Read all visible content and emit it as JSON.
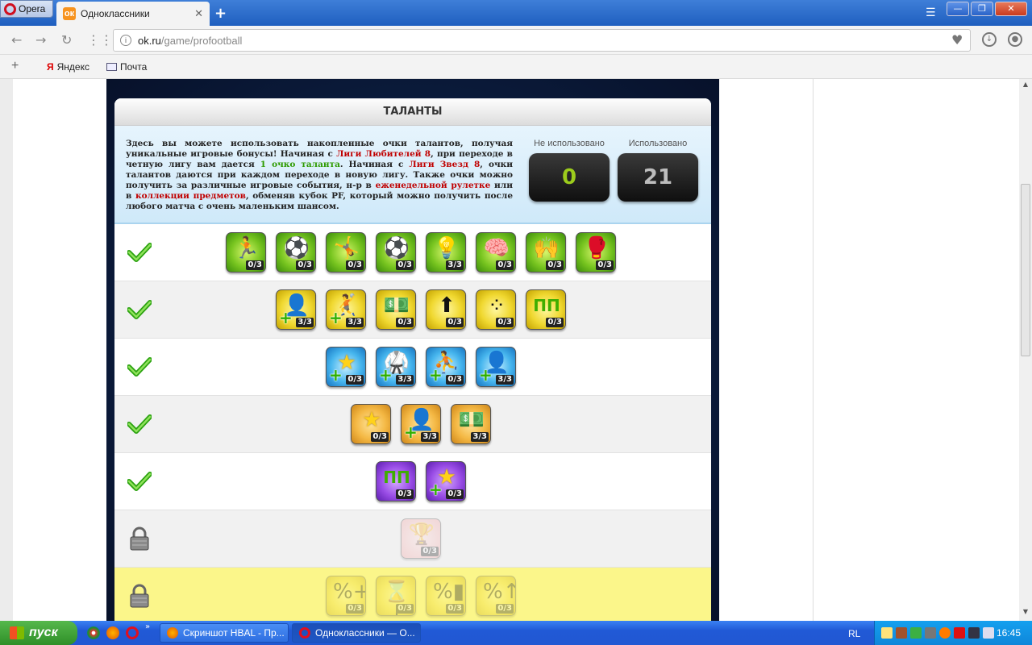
{
  "browser": {
    "menu_label": "Opera",
    "tab_title": "Одноклассники",
    "url_domain": "ok.ru",
    "url_path": "/game/profootball",
    "bookmarks": [
      {
        "label": "Яндекс"
      },
      {
        "label": "Почта"
      }
    ]
  },
  "panel": {
    "title": "ТАЛАНТЫ",
    "intro": {
      "p1": "Здесь вы можете использовать накопленные очки талантов, получая уникальные игровые бонусы! Начиная с ",
      "league1": "Лиги Любителей 8",
      "p2": ", при переходе в четную лигу вам дается ",
      "talent": "1 очко таланта",
      "p3": ". Начиная с ",
      "league2": "Лиги Звезд 8",
      "p4": ", очки талантов даются при каждом переходе в новую лигу. Также очки можно получить за различные игровые события, н-р в ",
      "roulette": "еженедельной рулетке",
      "p5": " или в ",
      "collection": "коллекции предметов",
      "p6": ", обменяв кубок PF, который можно получить после любого матча с очень маленьким шансом."
    },
    "unused_label": "Не использовано",
    "unused_value": "0",
    "used_label": "Использовано",
    "used_value": "21",
    "colors": {
      "unused": "#9ccc1c",
      "used": "#bdbdbd",
      "red": "#c00000",
      "green": "#2e9a00"
    }
  },
  "rows": [
    {
      "status": "unlocked",
      "color": "green",
      "talents": [
        {
          "icon": "running-player-icon",
          "count": "0/3"
        },
        {
          "icon": "kicking-player-icon",
          "count": "0/3"
        },
        {
          "icon": "shooting-player-icon",
          "count": "0/3"
        },
        {
          "icon": "dribbling-player-icon",
          "count": "0/3"
        },
        {
          "icon": "lightbulb-icon",
          "count": "3/3"
        },
        {
          "icon": "brain-head-icon",
          "count": "0/3"
        },
        {
          "icon": "athlete-icon",
          "count": "0/3"
        },
        {
          "icon": "boxing-gloves-icon",
          "count": "0/3"
        }
      ]
    },
    {
      "status": "unlocked",
      "color": "yellow",
      "talents": [
        {
          "icon": "player-plus-icon",
          "count": "3/3",
          "plus": true
        },
        {
          "icon": "sliding-player-plus-icon",
          "count": "3/3",
          "plus": true
        },
        {
          "icon": "money-plus-icon",
          "count": "0/3"
        },
        {
          "icon": "green-arrow-up-icon",
          "count": "0/3"
        },
        {
          "icon": "dots-formation-icon",
          "count": "0/3"
        },
        {
          "icon": "pp-icon",
          "count": "0/3"
        }
      ]
    },
    {
      "status": "unlocked",
      "color": "blue",
      "talents": [
        {
          "icon": "star-plus-icon",
          "count": "0/3",
          "plus": true
        },
        {
          "icon": "kick-plus-icon",
          "count": "3/3",
          "plus": true
        },
        {
          "icon": "tackle-plus-icon",
          "count": "0/3",
          "plus": true
        },
        {
          "icon": "player-plus-icon",
          "count": "3/3",
          "plus": true
        }
      ]
    },
    {
      "status": "unlocked",
      "color": "orange",
      "talents": [
        {
          "icon": "star-icon",
          "count": "0/3"
        },
        {
          "icon": "player-plus-icon",
          "count": "3/3",
          "plus": true
        },
        {
          "icon": "money-minus-icon",
          "count": "3/3"
        }
      ]
    },
    {
      "status": "unlocked",
      "color": "purple",
      "talents": [
        {
          "icon": "pp-icon",
          "count": "0/3"
        },
        {
          "icon": "star-plus-icon",
          "count": "0/3",
          "plus": true
        }
      ]
    },
    {
      "status": "locked",
      "color": "red",
      "talents": [
        {
          "icon": "trophy-question-icon",
          "count": "0/3"
        }
      ]
    },
    {
      "status": "locked",
      "color": "yellow",
      "talents": [
        {
          "icon": "percent-plus-icon",
          "count": "0/3"
        },
        {
          "icon": "percent-hourglass-plus-icon",
          "count": "0/3"
        },
        {
          "icon": "percent-card-icon",
          "count": "0/3"
        },
        {
          "icon": "percent-arrow-up-icon",
          "count": "0/3"
        }
      ]
    }
  ],
  "taskbar": {
    "start_label": "пуск",
    "tasks": [
      {
        "label": "Скриншот HBAL - Пр..."
      },
      {
        "label": "Одноклассники — О..."
      }
    ],
    "lang": "RL",
    "clock": "16:45"
  }
}
